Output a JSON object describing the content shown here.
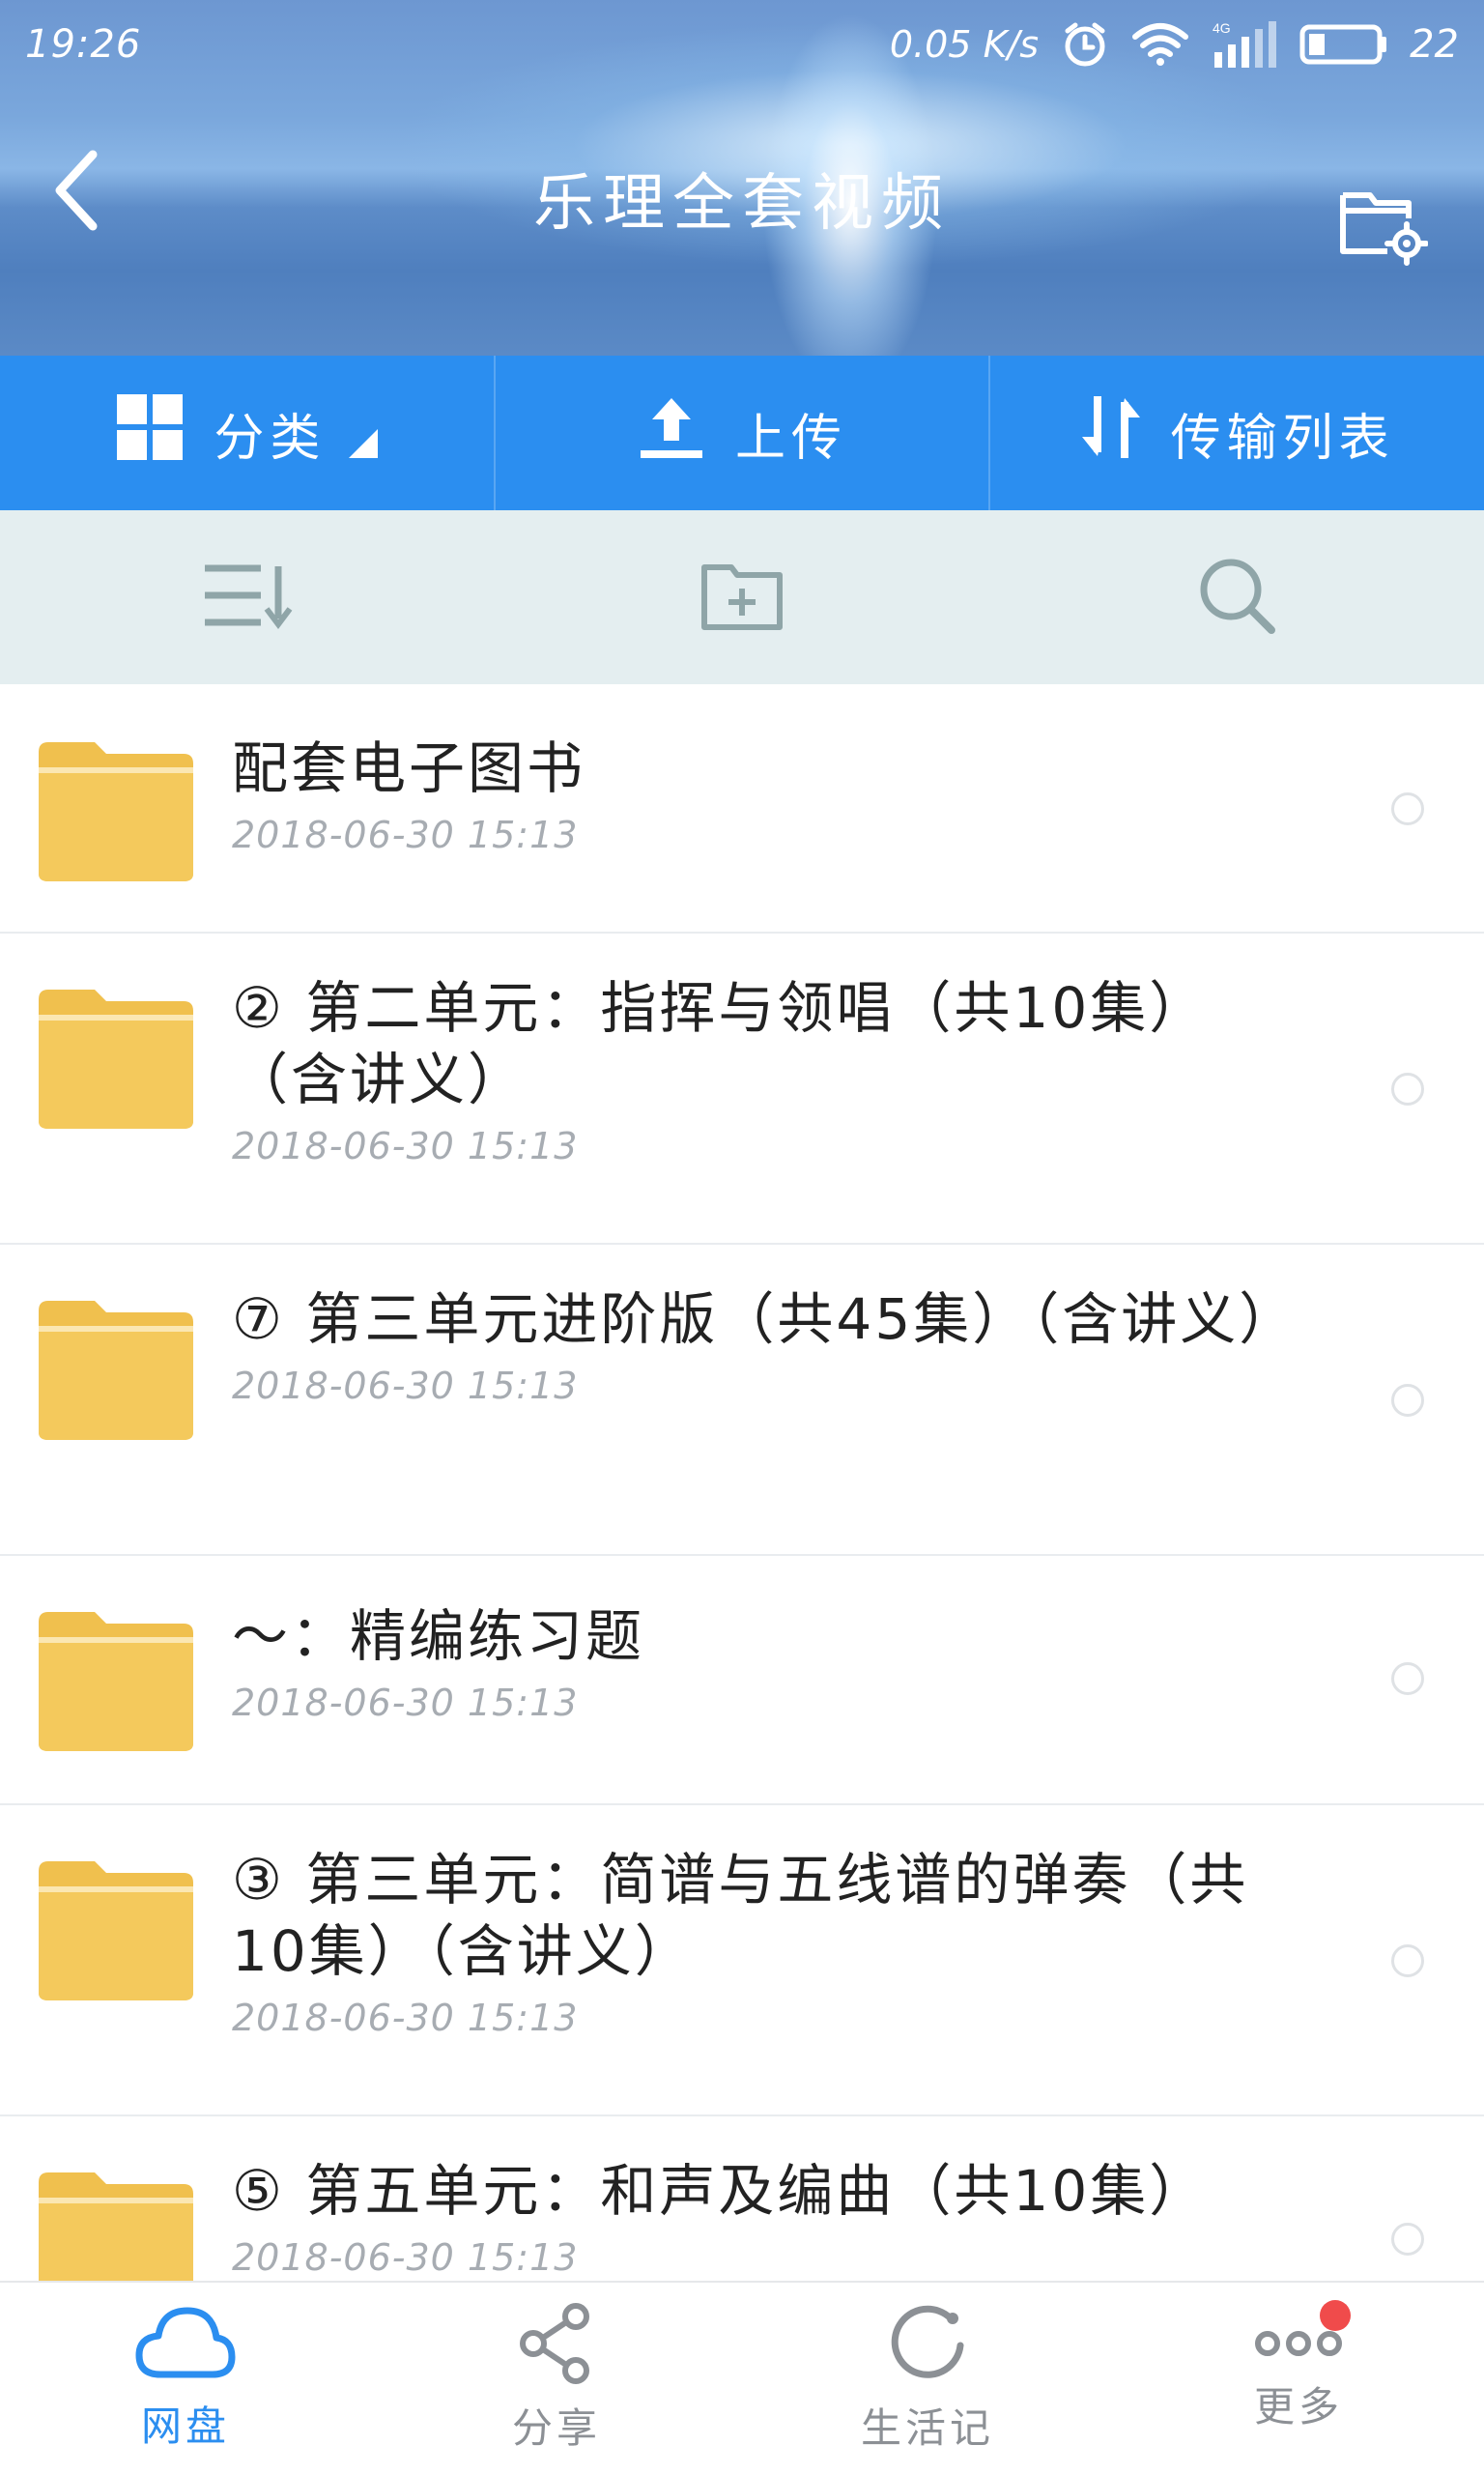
{
  "status_bar": {
    "time": "19:26",
    "net_speed": "0.05 K/s",
    "network": "4G",
    "battery": "22"
  },
  "header": {
    "title": "乐理全套视频",
    "back_icon": "chevron-left-icon",
    "settings_icon": "folder-settings-icon"
  },
  "actions": {
    "category_label": "分类",
    "upload_label": "上传",
    "transfer_label": "传输列表"
  },
  "tools": [
    "sort-icon",
    "new-folder-icon",
    "search-icon"
  ],
  "files": [
    {
      "name": "配套电子图书",
      "date": "2018-06-30  15:13"
    },
    {
      "name": "② 第二单元：指挥与领唱（共10集）（含讲义）",
      "date": "2018-06-30  15:13"
    },
    {
      "name": "⑦ 第三单元进阶版（共45集）（含讲义）",
      "date": "2018-06-30  15:13"
    },
    {
      "name": "～：精编练习题",
      "date": "2018-06-30  15:13"
    },
    {
      "name": "③ 第三单元：简谱与五线谱的弹奏（共10集）（含讲义）",
      "date": "2018-06-30  15:13"
    },
    {
      "name": "⑤ 第五单元：和声及编曲（共10集）",
      "date": "2018-06-30  15:13"
    }
  ],
  "bottom_nav": {
    "items": [
      {
        "label": "网盘",
        "icon": "cloud-icon",
        "active": true
      },
      {
        "label": "分享",
        "icon": "share-icon",
        "active": false
      },
      {
        "label": "生活记",
        "icon": "circle-icon",
        "active": false
      },
      {
        "label": "更多",
        "icon": "more-icon",
        "active": false
      }
    ]
  },
  "colors": {
    "accent": "#2b8ef0",
    "folder": "#f2c75a",
    "tool_bar": "#e4eef0",
    "badge": "#f04b4b"
  }
}
